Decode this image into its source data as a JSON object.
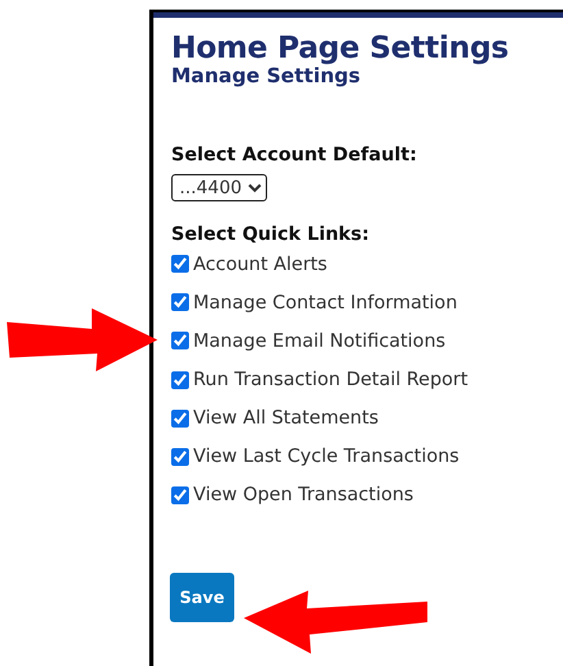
{
  "header": {
    "title": "Home Page Settings",
    "subtitle": "Manage Settings"
  },
  "account_default": {
    "label": "Select Account Default:",
    "value": "...4400"
  },
  "quick_links": {
    "label": "Select Quick Links:",
    "items": [
      {
        "label": "Account Alerts",
        "checked": true
      },
      {
        "label": "Manage Contact Information",
        "checked": true
      },
      {
        "label": "Manage Email Notifications",
        "checked": true
      },
      {
        "label": "Run Transaction Detail Report",
        "checked": true
      },
      {
        "label": "View All Statements",
        "checked": true
      },
      {
        "label": "View Last Cycle Transactions",
        "checked": true
      },
      {
        "label": "View Open Transactions",
        "checked": true
      }
    ]
  },
  "buttons": [
    {
      "label": "Save"
    }
  ]
}
